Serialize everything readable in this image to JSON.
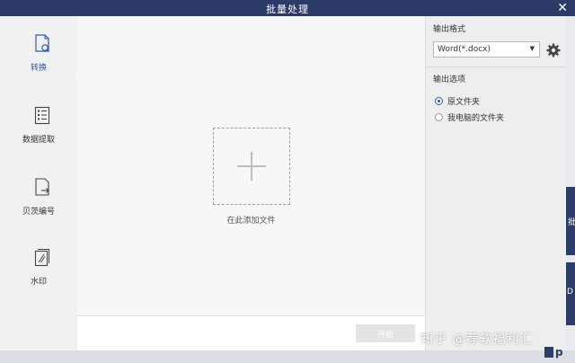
{
  "window": {
    "title": "批量处理",
    "close_glyph": "✕"
  },
  "sidebar": {
    "items": [
      {
        "label": "转换",
        "icon": "convert-icon",
        "active": true
      },
      {
        "label": "数据提取",
        "icon": "data-extract-icon",
        "active": false
      },
      {
        "label": "贝茨编号",
        "icon": "bates-number-icon",
        "active": false
      },
      {
        "label": "水印",
        "icon": "watermark-icon",
        "active": false
      }
    ]
  },
  "main": {
    "drop_hint": "在此添加文件",
    "start_label": "开始"
  },
  "right_panel": {
    "output_format_title": "输出格式",
    "format_value": "Word(*.docx)",
    "output_options_title": "输出选项",
    "options": [
      {
        "label": "原文件夹",
        "checked": true
      },
      {
        "label": "我电脑的文件夹",
        "checked": false
      }
    ]
  },
  "background_app": {
    "fragment_1": "批",
    "fragment_2": "D",
    "fragment_3": "p"
  },
  "watermark_text": "知乎 @荐软福利汇",
  "colors": {
    "titlebar": "#2b3a67",
    "accent": "#2e56b8",
    "panel": "#eeeeef"
  }
}
